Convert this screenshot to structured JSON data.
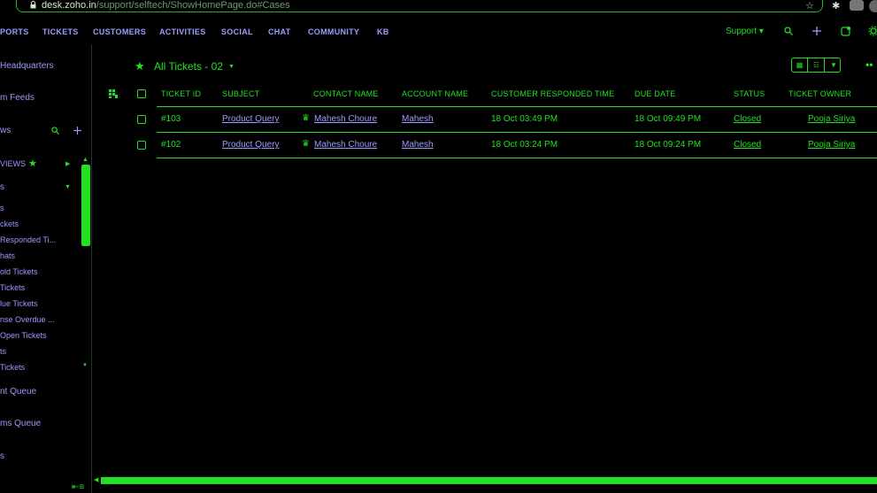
{
  "browser": {
    "url_host": "desk.zoho.in",
    "url_path": "/support/selftech/ShowHomePage.do#Cases"
  },
  "nav": {
    "items": [
      "PORTS",
      "TICKETS",
      "CUSTOMERS",
      "ACTIVITIES",
      "SOCIAL",
      "CHAT",
      "COMMUNITY",
      "KB"
    ],
    "department": "Support ▾"
  },
  "sidebar": {
    "headquarters": "Headquarters",
    "feeds": "m Feeds",
    "views": "ws",
    "views_header": "VIEWS",
    "section": "s",
    "list": [
      "s",
      "ckets",
      "Responded Ti...",
      "hats",
      "old Tickets",
      "Tickets",
      "lue Tickets",
      "nse Overdue ...",
      "Open Tickets",
      "ts",
      "Tickets"
    ],
    "queue1": "nt Queue",
    "queue2": "ms Queue",
    "last": "s"
  },
  "main": {
    "view_title": "All Tickets - 02",
    "columns": [
      "TICKET ID",
      "SUBJECT",
      "CONTACT NAME",
      "ACCOUNT NAME",
      "CUSTOMER RESPONDED TIME",
      "DUE DATE",
      "STATUS",
      "TICKET OWNER"
    ],
    "rows": [
      {
        "id": "#103",
        "subject": "Product Query",
        "contact": "Mahesh Choure",
        "account": "Mahesh",
        "responded": "18 Oct 03:49 PM",
        "due": "18 Oct 09:49 PM",
        "status": "Closed",
        "owner": "Pooja Siriya"
      },
      {
        "id": "#102",
        "subject": "Product Query",
        "contact": "Mahesh Choure",
        "account": "Mahesh",
        "responded": "18 Oct 03:24 PM",
        "due": "18 Oct 09:24 PM",
        "status": "Closed",
        "owner": "Pooja Siriya"
      }
    ]
  },
  "colors": {
    "accent": "#22e022",
    "link": "#9b9bff",
    "background": "#000000"
  },
  "icons": [
    "lock-icon",
    "bookmark-star-icon",
    "extensions-icon",
    "search-icon",
    "plus-icon",
    "compose-icon",
    "settings-icon",
    "star-icon",
    "crown-icon",
    "table-view-icon",
    "kanban-view-icon",
    "dropdown-icon",
    "more-icon",
    "column-chooser-icon",
    "collapse-icon"
  ]
}
